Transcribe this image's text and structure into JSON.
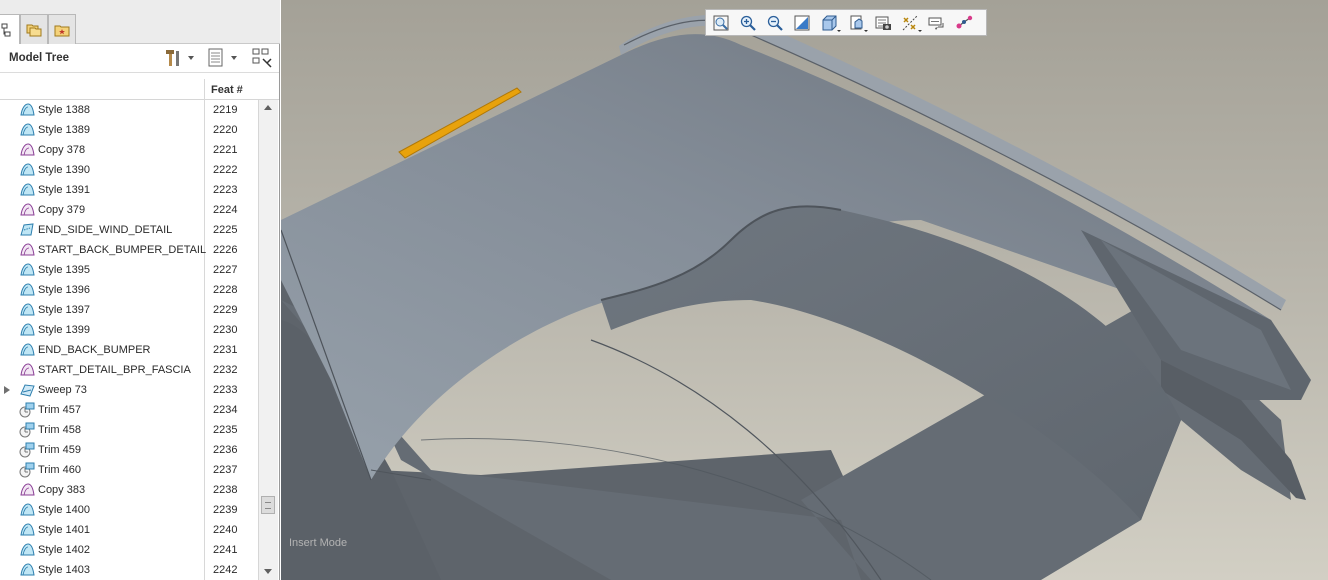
{
  "panel": {
    "tabs": [
      {
        "name": "model-tree-tab",
        "icon": "model-tree-icon"
      },
      {
        "name": "folder-browser-tab",
        "icon": "folder-browser-icon"
      },
      {
        "name": "favorites-tab",
        "icon": "favorites-icon"
      }
    ],
    "title": "Model Tree",
    "tools": [
      "settings-hammer-icon",
      "show-columns-icon",
      "tree-filters-icon"
    ],
    "column_header": "Feat #"
  },
  "tree": {
    "rows": [
      {
        "name": "Style 1388",
        "feat": "2219",
        "icon": "style-icon"
      },
      {
        "name": "Style 1389",
        "feat": "2220",
        "icon": "style-icon"
      },
      {
        "name": "Copy 378",
        "feat": "2221",
        "icon": "copy-icon"
      },
      {
        "name": "Style 1390",
        "feat": "2222",
        "icon": "style-icon"
      },
      {
        "name": "Style 1391",
        "feat": "2223",
        "icon": "style-icon"
      },
      {
        "name": "Copy 379",
        "feat": "2224",
        "icon": "copy-icon"
      },
      {
        "name": "END_SIDE_WIND_DETAIL",
        "feat": "2225",
        "icon": "group-end-icon"
      },
      {
        "name": "START_BACK_BUMPER_DETAIL",
        "feat": "2226",
        "icon": "copy-icon"
      },
      {
        "name": "Style 1395",
        "feat": "2227",
        "icon": "style-icon"
      },
      {
        "name": "Style 1396",
        "feat": "2228",
        "icon": "style-icon"
      },
      {
        "name": "Style 1397",
        "feat": "2229",
        "icon": "style-icon"
      },
      {
        "name": "Style 1399",
        "feat": "2230",
        "icon": "style-icon"
      },
      {
        "name": "END_BACK_BUMPER",
        "feat": "2231",
        "icon": "style-icon"
      },
      {
        "name": "START_DETAIL_BPR_FASCIA",
        "feat": "2232",
        "icon": "copy-icon"
      },
      {
        "name": "Sweep 73",
        "feat": "2233",
        "icon": "sweep-icon",
        "expandable": true
      },
      {
        "name": "Trim 457",
        "feat": "2234",
        "icon": "trim-icon"
      },
      {
        "name": "Trim 458",
        "feat": "2235",
        "icon": "trim-icon"
      },
      {
        "name": "Trim 459",
        "feat": "2236",
        "icon": "trim-icon"
      },
      {
        "name": "Trim 460",
        "feat": "2237",
        "icon": "trim-icon"
      },
      {
        "name": "Copy 383",
        "feat": "2238",
        "icon": "copy-icon"
      },
      {
        "name": "Style 1400",
        "feat": "2239",
        "icon": "style-icon"
      },
      {
        "name": "Style 1401",
        "feat": "2240",
        "icon": "style-icon"
      },
      {
        "name": "Style 1402",
        "feat": "2241",
        "icon": "style-icon"
      },
      {
        "name": "Style 1403",
        "feat": "2242",
        "icon": "style-icon"
      }
    ]
  },
  "graphics": {
    "mode_label": "Insert Mode",
    "toolbar": [
      {
        "name": "refit-button",
        "icon": "refit-icon"
      },
      {
        "name": "zoom-in-button",
        "icon": "zoom-in-icon"
      },
      {
        "name": "zoom-out-button",
        "icon": "zoom-out-icon"
      },
      {
        "name": "repaint-button",
        "icon": "repaint-icon"
      },
      {
        "name": "display-style-button",
        "icon": "display-style-icon",
        "menu": true
      },
      {
        "name": "saved-views-button",
        "icon": "saved-views-icon",
        "menu": true
      },
      {
        "name": "view-manager-button",
        "icon": "view-manager-icon"
      },
      {
        "name": "datum-display-button",
        "icon": "datum-display-icon",
        "menu": true
      },
      {
        "name": "annotation-display-button",
        "icon": "annotation-display-icon"
      },
      {
        "name": "spin-center-button",
        "icon": "spin-center-icon"
      }
    ],
    "colors": {
      "surface": "#7f8792",
      "highlight": "#e8a20c",
      "background_top": "#a4a197",
      "background_bottom": "#d2cfc4"
    }
  }
}
